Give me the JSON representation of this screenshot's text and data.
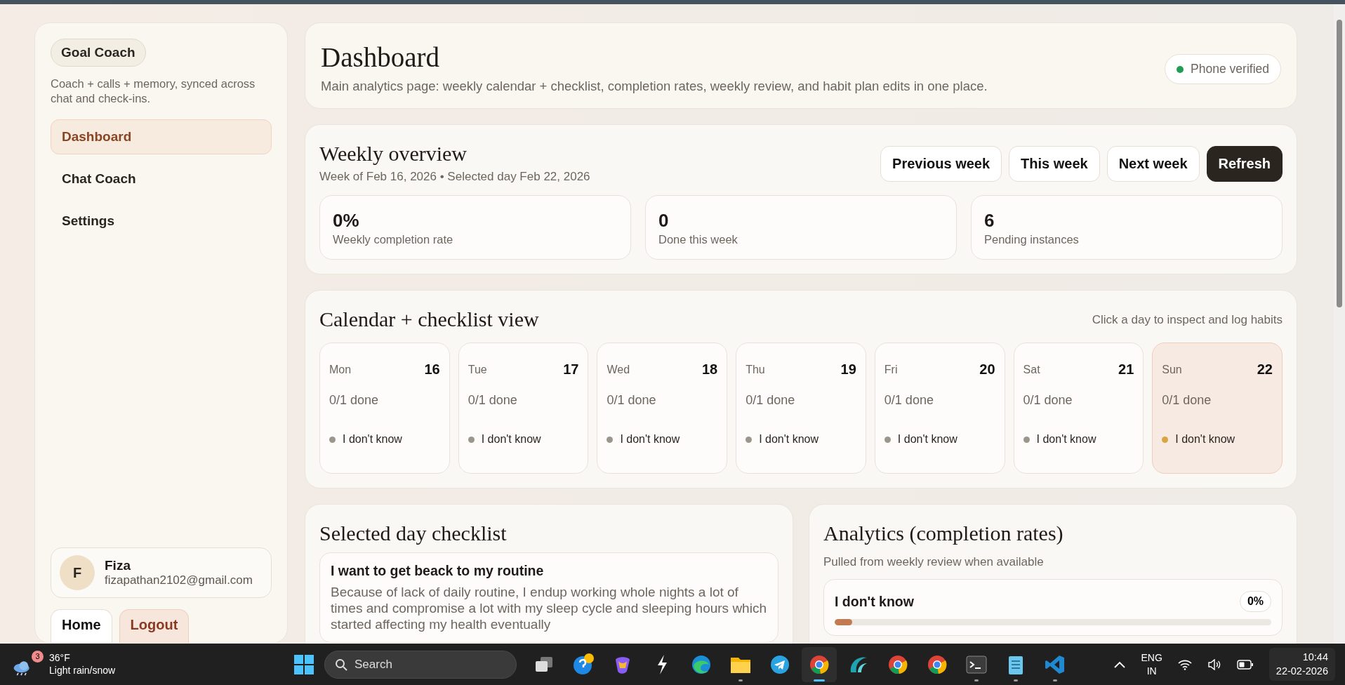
{
  "sidebar": {
    "brand": "Goal Coach",
    "tagline": "Coach + calls + memory, synced across chat and check-ins.",
    "nav": [
      {
        "label": "Dashboard",
        "selected": true
      },
      {
        "label": "Chat Coach",
        "selected": false
      },
      {
        "label": "Settings",
        "selected": false
      }
    ],
    "user": {
      "initial": "F",
      "name": "Fiza",
      "email": "fizapathan2102@gmail.com"
    },
    "buttons": [
      {
        "label": "Home",
        "kind": "plain"
      },
      {
        "label": "Logout",
        "kind": "danger"
      }
    ]
  },
  "header": {
    "title": "Dashboard",
    "subtitle": "Main analytics page: weekly calendar + checklist, completion rates, weekly review, and habit plan edits in one place.",
    "status": {
      "label": "Phone verified",
      "color": "#1f9d55"
    }
  },
  "weekly": {
    "title": "Weekly overview",
    "subtitle": "Week of Feb 16, 2026 • Selected day Feb 22, 2026",
    "buttons": [
      {
        "label": "Previous week",
        "primary": false
      },
      {
        "label": "This week",
        "primary": false
      },
      {
        "label": "Next week",
        "primary": false
      },
      {
        "label": "Refresh",
        "primary": true
      }
    ],
    "stats": [
      {
        "value": "0%",
        "label": "Weekly completion rate"
      },
      {
        "value": "0",
        "label": "Done this week"
      },
      {
        "value": "6",
        "label": "Pending instances"
      }
    ]
  },
  "calendar": {
    "title": "Calendar + checklist view",
    "hint": "Click a day to inspect and log habits",
    "days": [
      {
        "weekday": "Mon",
        "date": "16",
        "progress": "0/1 done",
        "habit": "I don't know",
        "color": "#9b968c",
        "selected": false
      },
      {
        "weekday": "Tue",
        "date": "17",
        "progress": "0/1 done",
        "habit": "I don't know",
        "color": "#9b968c",
        "selected": false
      },
      {
        "weekday": "Wed",
        "date": "18",
        "progress": "0/1 done",
        "habit": "I don't know",
        "color": "#9b968c",
        "selected": false
      },
      {
        "weekday": "Thu",
        "date": "19",
        "progress": "0/1 done",
        "habit": "I don't know",
        "color": "#9b968c",
        "selected": false
      },
      {
        "weekday": "Fri",
        "date": "20",
        "progress": "0/1 done",
        "habit": "I don't know",
        "color": "#9b968c",
        "selected": false
      },
      {
        "weekday": "Sat",
        "date": "21",
        "progress": "0/1 done",
        "habit": "I don't know",
        "color": "#9b968c",
        "selected": false
      },
      {
        "weekday": "Sun",
        "date": "22",
        "progress": "0/1 done",
        "habit": "I don't know",
        "color": "#d9a441",
        "selected": true
      }
    ]
  },
  "checklist": {
    "title": "Selected day checklist",
    "items": [
      {
        "title": "I want to get beack to my routine",
        "description": "Because of lack of daily routine, I endup working whole nights a lot of times and compromise a lot with my sleep cycle and sleeping hours which started affecting my health eventually"
      }
    ]
  },
  "analytics": {
    "title": "Analytics (completion rates)",
    "subtitle": "Pulled from weekly review when available",
    "habits": [
      {
        "name": "I don't know",
        "percent": "0%",
        "level": 0.04
      }
    ]
  },
  "taskbar": {
    "weather": {
      "badge": "3",
      "temperature": "36°F",
      "condition": "Light rain/snow"
    },
    "search": "Search",
    "apps": [
      {
        "kind": "task-view",
        "running": false,
        "active": false
      },
      {
        "kind": "help",
        "running": false,
        "active": false
      },
      {
        "kind": "copilot",
        "running": false,
        "active": false
      },
      {
        "kind": "bolt",
        "running": false,
        "active": false
      },
      {
        "kind": "edge",
        "running": false,
        "active": false
      },
      {
        "kind": "folder",
        "running": true,
        "active": false
      },
      {
        "kind": "telegram",
        "running": false,
        "active": false
      },
      {
        "kind": "chrome",
        "running": true,
        "active": true
      },
      {
        "kind": "wave",
        "running": false,
        "active": false
      },
      {
        "kind": "chrome",
        "running": false,
        "active": false
      },
      {
        "kind": "chrome",
        "running": false,
        "active": false
      },
      {
        "kind": "terminal",
        "running": true,
        "active": false
      },
      {
        "kind": "notepad",
        "running": true,
        "active": false
      },
      {
        "kind": "vscode",
        "running": true,
        "active": false
      }
    ],
    "language": [
      "ENG",
      "IN"
    ],
    "time": "10:44",
    "date": "22-02-2026"
  }
}
